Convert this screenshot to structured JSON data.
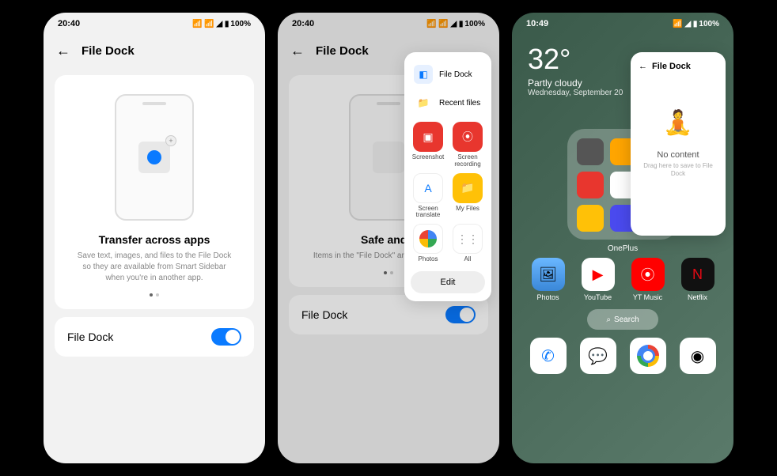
{
  "screen1": {
    "status": {
      "time": "20:40",
      "battery": "100%"
    },
    "header": {
      "title": "File Dock"
    },
    "card": {
      "title": "Transfer across apps",
      "desc": "Save text, images, and files to the File Dock so they are available from Smart Sidebar when you're in another app."
    },
    "toggle": {
      "label": "File Dock"
    }
  },
  "screen2": {
    "status": {
      "time": "20:40",
      "battery": "100%"
    },
    "header": {
      "title": "File Dock"
    },
    "card": {
      "title": "Safe and s",
      "desc": "Items in the \"File Dock\" are before they're r"
    },
    "toggle": {
      "label": "File Dock"
    },
    "sidebar": {
      "items": [
        {
          "label": "File Dock"
        },
        {
          "label": "Recent files"
        }
      ],
      "tools": [
        {
          "label": "Screenshot"
        },
        {
          "label": "Screen recording"
        },
        {
          "label": "Screen translate"
        },
        {
          "label": "My Files"
        },
        {
          "label": "Photos"
        },
        {
          "label": "All"
        }
      ],
      "edit": "Edit"
    }
  },
  "screen3": {
    "status": {
      "time": "10:49",
      "battery": "100%"
    },
    "weather": {
      "temp": "32°",
      "cond": "Partly cloudy",
      "date": "Wednesday, September 20"
    },
    "folder": {
      "label": "OnePlus"
    },
    "apps": [
      {
        "label": "Photos"
      },
      {
        "label": "YouTube"
      },
      {
        "label": "YT Music"
      },
      {
        "label": "Netflix"
      }
    ],
    "search": "Search",
    "fileDock": {
      "title": "File Dock",
      "noContent": "No content",
      "desc": "Drag here to save to File Dock"
    }
  }
}
